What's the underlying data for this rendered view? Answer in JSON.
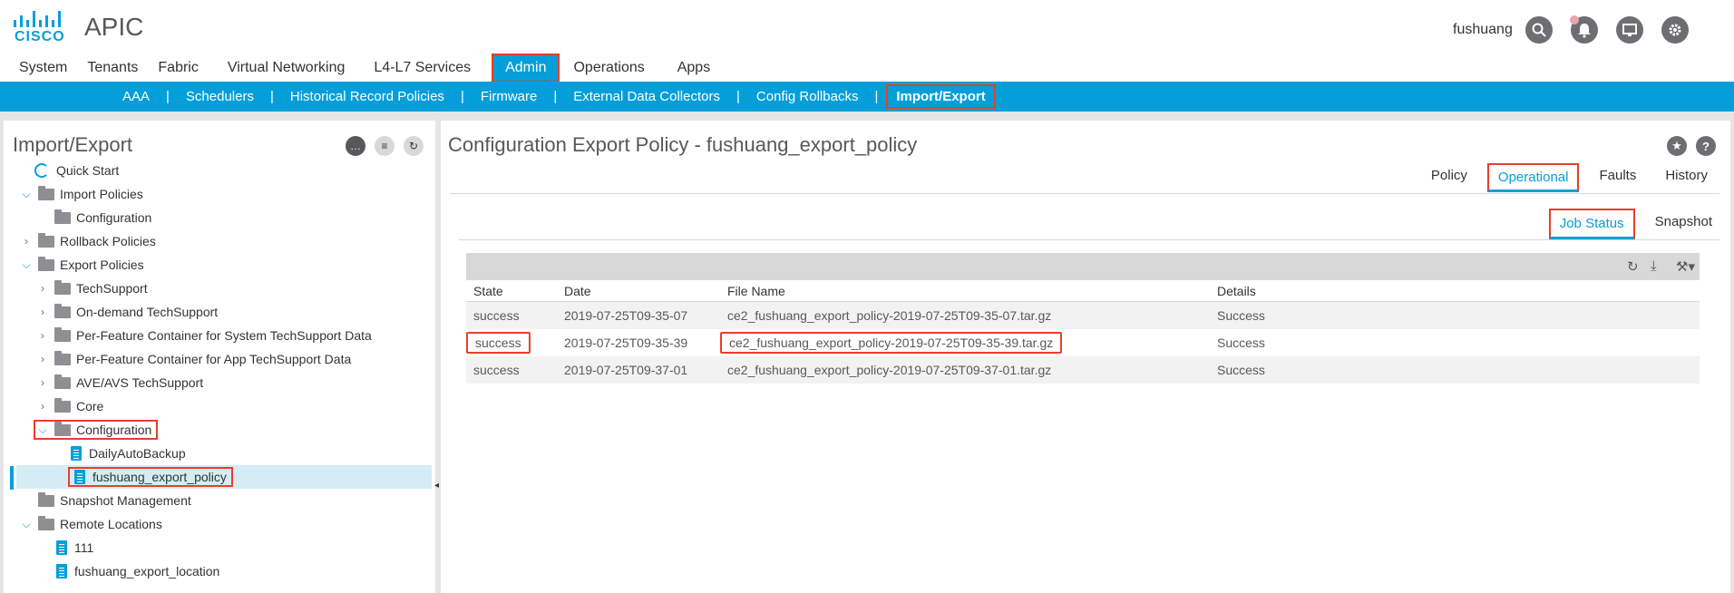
{
  "app": {
    "logo_text": "CISCO",
    "title": "APIC",
    "user": "fushuang",
    "icons": [
      "search-icon",
      "bell-icon",
      "monitor-icon",
      "gear-icon"
    ]
  },
  "main_nav": [
    {
      "label": "System"
    },
    {
      "label": "Tenants"
    },
    {
      "label": "Fabric"
    },
    {
      "label": "Virtual Networking"
    },
    {
      "label": "L4-L7 Services"
    },
    {
      "label": "Admin",
      "active": true
    },
    {
      "label": "Operations"
    },
    {
      "label": "Apps"
    }
  ],
  "sub_nav": [
    {
      "label": "AAA"
    },
    {
      "label": "Schedulers"
    },
    {
      "label": "Historical Record Policies"
    },
    {
      "label": "Firmware"
    },
    {
      "label": "External Data Collectors"
    },
    {
      "label": "Config Rollbacks"
    },
    {
      "label": "Import/Export",
      "active": true
    }
  ],
  "sub_nav_sep": "|",
  "left_panel": {
    "title": "Import/Export",
    "tree": [
      {
        "label": "Quick Start",
        "icon": "quick-start-icon"
      },
      {
        "label": "Import Policies",
        "icon": "folder-icon",
        "expanded": true
      },
      {
        "label": "Configuration",
        "icon": "folder-icon"
      },
      {
        "label": "Rollback Policies",
        "icon": "folder-icon",
        "expanded": false
      },
      {
        "label": "Export Policies",
        "icon": "folder-icon",
        "expanded": true
      },
      {
        "label": "TechSupport",
        "icon": "folder-icon",
        "expanded": false
      },
      {
        "label": "On-demand TechSupport",
        "icon": "folder-icon",
        "expanded": false
      },
      {
        "label": "Per-Feature Container for System TechSupport Data",
        "icon": "folder-icon",
        "expanded": false
      },
      {
        "label": "Per-Feature Container for App TechSupport Data",
        "icon": "folder-icon",
        "expanded": false
      },
      {
        "label": "AVE/AVS TechSupport",
        "icon": "folder-icon",
        "expanded": false
      },
      {
        "label": "Core",
        "icon": "folder-icon",
        "expanded": false
      },
      {
        "label": "Configuration",
        "icon": "folder-icon",
        "expanded": true
      },
      {
        "label": "DailyAutoBackup",
        "icon": "document-icon"
      },
      {
        "label": "fushuang_export_policy",
        "icon": "document-icon",
        "selected": true
      },
      {
        "label": "Snapshot Management",
        "icon": "folder-icon"
      },
      {
        "label": "Remote Locations",
        "icon": "folder-icon",
        "expanded": true
      },
      {
        "label": "111",
        "icon": "document-icon"
      },
      {
        "label": "fushuang_export_location",
        "icon": "document-icon"
      }
    ]
  },
  "right_panel": {
    "title": "Configuration Export Policy - fushuang_export_policy",
    "tabs": [
      {
        "label": "Policy"
      },
      {
        "label": "Operational",
        "active": true
      },
      {
        "label": "Faults"
      },
      {
        "label": "History"
      }
    ],
    "sub_tabs": [
      {
        "label": "Job Status",
        "active": true
      },
      {
        "label": "Snapshot"
      }
    ],
    "table": {
      "columns": [
        "State",
        "Date",
        "File Name",
        "Details"
      ],
      "rows": [
        [
          "success",
          "2019-07-25T09-35-07",
          "ce2_fushuang_export_policy-2019-07-25T09-35-07.tar.gz",
          "Success"
        ],
        [
          "success",
          "2019-07-25T09-35-39",
          "ce2_fushuang_export_policy-2019-07-25T09-35-39.tar.gz",
          "Success"
        ],
        [
          "success",
          "2019-07-25T09-37-01",
          "ce2_fushuang_export_policy-2019-07-25T09-37-01.tar.gz",
          "Success"
        ]
      ]
    }
  },
  "colors": {
    "accent": "#049fd9",
    "highlight": "#e5402b",
    "icon_gray": "#6d6e71"
  }
}
